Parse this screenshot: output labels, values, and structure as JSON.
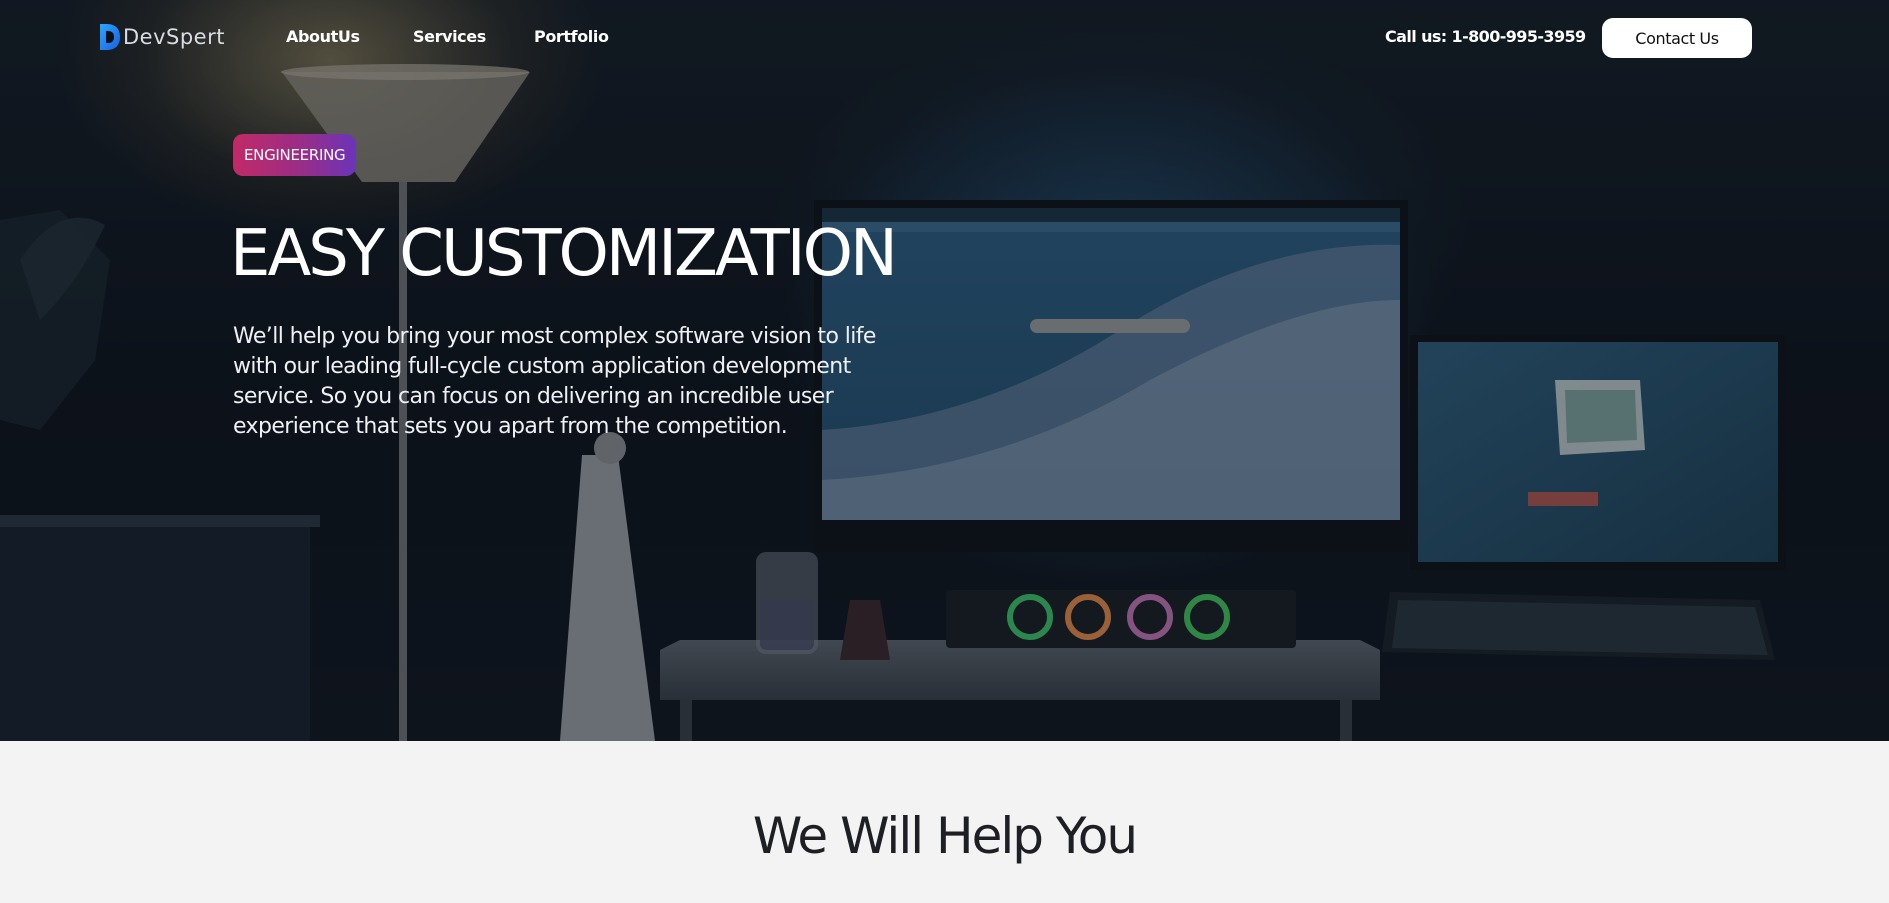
{
  "brand": {
    "name": "DevSpert",
    "logo_icon": "devspert-logo-mark",
    "colors": {
      "logo_gradient": [
        "#2aa8ff",
        "#1a5fe0"
      ],
      "badge_gradient": [
        "#c22a67",
        "#6b34b8"
      ],
      "page_bg": "#f3f3f3",
      "heading_dark": "#1e1f24"
    }
  },
  "nav": {
    "links": [
      {
        "label": "AboutUs"
      },
      {
        "label": "Services"
      },
      {
        "label": "Portfolio"
      }
    ],
    "call": "Call us: 1-800-995-3959",
    "contact_label": "Contact Us"
  },
  "hero": {
    "badge": "ENGINEERING",
    "title": "EASY CUSTOMIZATION",
    "description": "We’ll help you bring your most complex software vision to life with our leading full-cycle custom application development service. So you can focus on delivering an incredible user experience that sets you apart from the competition.",
    "background_image": "dark desk setup with monitors, lamp and keyboard"
  },
  "section": {
    "title": "We Will Help You"
  }
}
